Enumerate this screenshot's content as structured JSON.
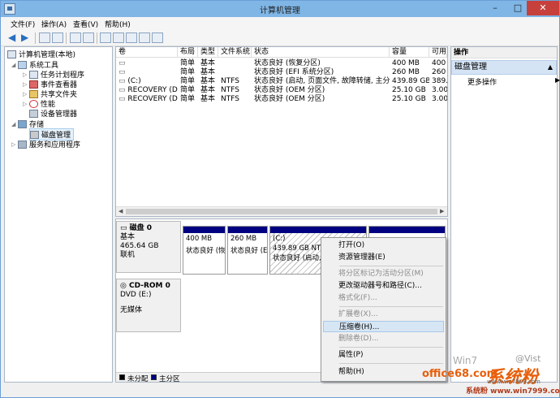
{
  "window": {
    "title": "计算机管理",
    "minimize": "–",
    "maximize": "□",
    "close": "✕"
  },
  "menu": [
    "文件(F)",
    "操作(A)",
    "查看(V)",
    "帮助(H)"
  ],
  "tree": {
    "root": "计算机管理(本地)",
    "system_tools": "系统工具",
    "task_scheduler": "任务计划程序",
    "event_viewer": "事件查看器",
    "shared_folders": "共享文件夹",
    "performance": "性能",
    "device_manager": "设备管理器",
    "storage": "存储",
    "disk_management": "磁盘管理",
    "services": "服务和应用程序"
  },
  "volume_table": {
    "headers": [
      "卷",
      "布局",
      "类型",
      "文件系统",
      "状态",
      "容量",
      "可用"
    ],
    "rows": [
      [
        "",
        "简单",
        "基本",
        "",
        "状态良好 (恢复分区)",
        "400 MB",
        "400"
      ],
      [
        "",
        "简单",
        "基本",
        "",
        "状态良好 (EFI 系统分区)",
        "260 MB",
        "260"
      ],
      [
        "(C:)",
        "简单",
        "基本",
        "NTFS",
        "状态良好 (启动, 页面文件, 故障转储, 主分区)",
        "439.89 GB",
        "389."
      ],
      [
        "RECOVERY (D:)",
        "简单",
        "基本",
        "NTFS",
        "状态良好 (OEM 分区)",
        "25.10 GB",
        "3.00"
      ],
      [
        "RECOVERY (D:)",
        "简单",
        "基本",
        "NTFS",
        "状态良好 (OEM 分区)",
        "25.10 GB",
        "3.00"
      ]
    ]
  },
  "disks": {
    "disk0": {
      "name": "磁盘 0",
      "type": "基本",
      "size": "465.64 GB",
      "status": "联机"
    },
    "partitions": [
      {
        "size": "400 MB",
        "status": "状态良好 (恢"
      },
      {
        "size": "260 MB",
        "status": "状态良好 (E"
      },
      {
        "label": "(C:)",
        "size": "439.89 GB NTF",
        "status": "状态良好 (启动,"
      },
      {
        "size": "",
        "status": ""
      }
    ],
    "cdrom": {
      "name": "CD-ROM 0",
      "drive": "DVD (E:)",
      "media": "无媒体"
    }
  },
  "legend": {
    "unallocated": "未分配",
    "primary": "主分区"
  },
  "actions": {
    "header": "操作",
    "section": "磁盘管理",
    "more": "更多操作"
  },
  "context_menu": {
    "open": "打开(O)",
    "explore": "资源管理器(E)",
    "mark_active": "将分区标记为活动分区(M)",
    "change_letter": "更改驱动器号和路径(C)...",
    "format": "格式化(F)...",
    "extend": "扩展卷(X)...",
    "shrink": "压缩卷(H)...",
    "delete": "删除卷(D)...",
    "properties": "属性(P)",
    "help": "帮助(H)"
  },
  "watermarks": [
    "系统粉",
    "office68.com",
    "系统粉 www.win7999.com",
    "Win7",
    "@Vist",
    "www.win7999.com"
  ],
  "colors": {
    "primary_partition": "#000080",
    "titlebar": "#7fb6e6",
    "close_button": "#c7413c",
    "watermark": "#e85f0b"
  }
}
